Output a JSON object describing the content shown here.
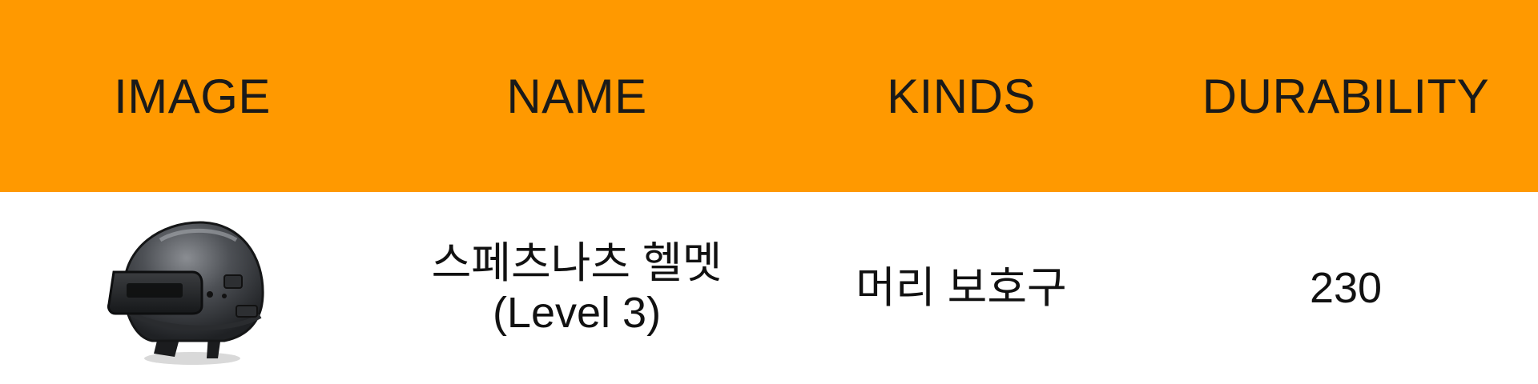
{
  "header": {
    "columns": [
      "IMAGE",
      "NAME",
      "KINDS",
      "DURABILITY"
    ]
  },
  "row": {
    "image_icon": "helmet-icon",
    "name_line1": "스페츠나츠 헬멧",
    "name_line2": "(Level 3)",
    "kind": "머리 보호구",
    "durability": "230"
  },
  "colors": {
    "header_bg": "#ff9900",
    "body_bg": "#ffffff",
    "text": "#111111"
  }
}
